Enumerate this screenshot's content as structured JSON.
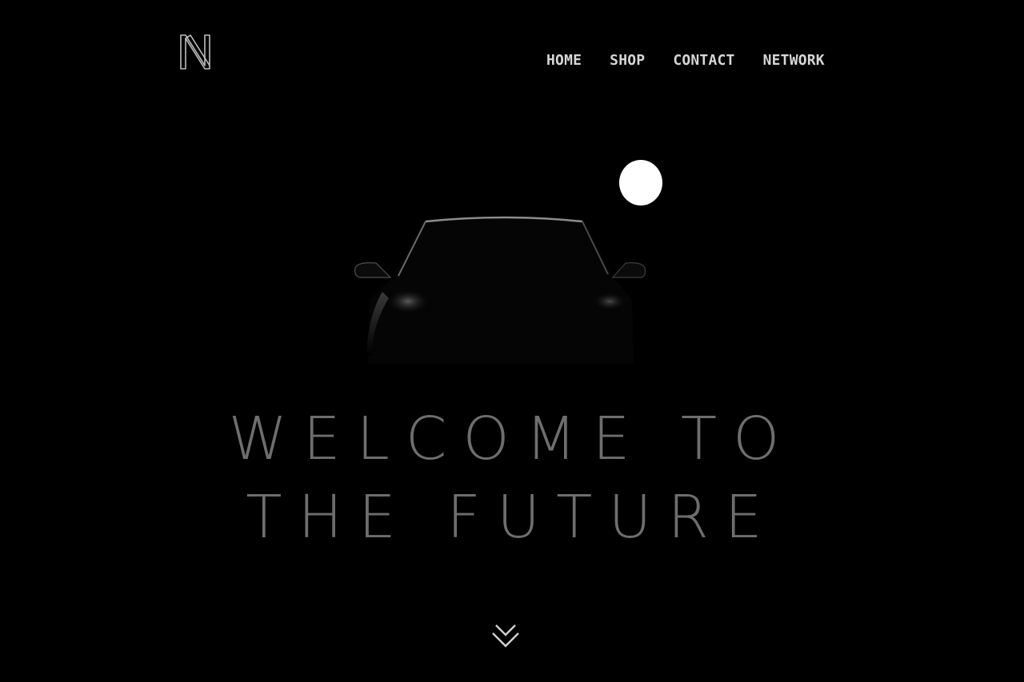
{
  "header": {
    "logo_icon": "n-monogram-logo"
  },
  "nav": {
    "items": [
      {
        "label": "HOME"
      },
      {
        "label": "SHOP"
      },
      {
        "label": "CONTACT"
      },
      {
        "label": "NETWORK"
      }
    ]
  },
  "hero": {
    "line1": "WELCOME TO",
    "line2": "THE FUTURE",
    "scroll_icon": "double-chevron-down-icon"
  },
  "colors": {
    "background": "#000000",
    "nav_text": "#d6d6d6",
    "hero_text": "#6e6e6e",
    "moon": "#ffffff"
  }
}
